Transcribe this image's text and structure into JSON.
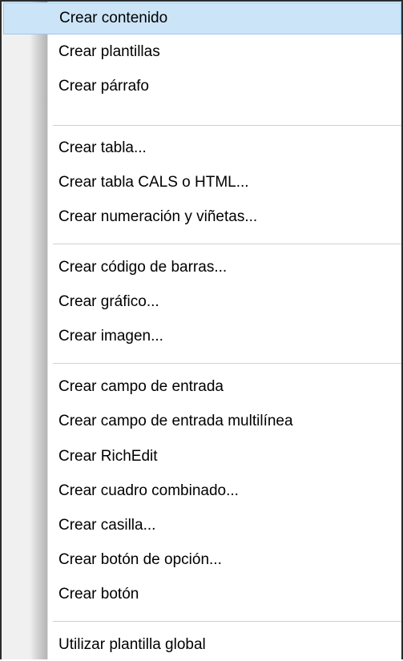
{
  "menu": {
    "items": [
      {
        "label": "Crear contenido",
        "highlighted": true
      },
      {
        "label": "Crear plantillas"
      },
      {
        "label": "Crear párrafo"
      },
      {
        "label": "Crear tabla..."
      },
      {
        "label": "Crear tabla CALS o HTML..."
      },
      {
        "label": "Crear numeración y viñetas..."
      },
      {
        "label": "Crear código de barras..."
      },
      {
        "label": "Crear gráfico..."
      },
      {
        "label": "Crear imagen..."
      },
      {
        "label": "Crear campo de entrada"
      },
      {
        "label": "Crear campo de entrada multilínea"
      },
      {
        "label": "Crear RichEdit"
      },
      {
        "label": "Crear cuadro combinado..."
      },
      {
        "label": "Crear casilla..."
      },
      {
        "label": "Crear botón de opción..."
      },
      {
        "label": "Crear botón"
      },
      {
        "label": "Utilizar plantilla global"
      }
    ]
  },
  "colors": {
    "highlight_bg": "#cce4f7",
    "highlight_border": "#99c9ef",
    "separator": "#d0d0d0",
    "gutter": "#f0f0f0"
  }
}
